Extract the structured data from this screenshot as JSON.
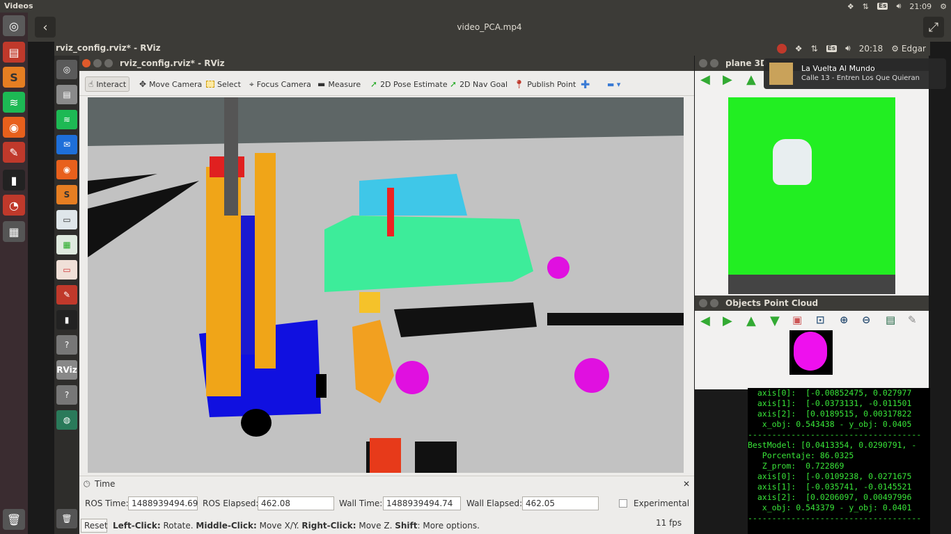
{
  "topbar": {
    "app_name": "Videos",
    "time": "21:09",
    "lang": "Es"
  },
  "video": {
    "title": "video_PCA.mp4",
    "back_icon": "chevron-left-icon",
    "fullscreen_icon": "fullscreen-icon"
  },
  "inner_top": {
    "title": "rviz_config.rviz* - RViz",
    "time": "20:18",
    "lang": "Es",
    "user": "Edgar"
  },
  "notification": {
    "title": "La Vuelta Al Mundo",
    "subtitle": "Calle 13 - Entren Los Que Quieran"
  },
  "rviz": {
    "title": "rviz_config.rviz* - RViz",
    "tools": [
      "Interact",
      "Move Camera",
      "Select",
      "Focus Camera",
      "Measure",
      "2D Pose Estimate",
      "2D Nav Goal",
      "Publish Point"
    ],
    "time_panel": {
      "title": "Time",
      "ros_time_label": "ROS Time:",
      "ros_time": "1488939494.69",
      "ros_elapsed_label": "ROS Elapsed:",
      "ros_elapsed": "462.08",
      "wall_time_label": "Wall Time:",
      "wall_time": "1488939494.74",
      "wall_elapsed_label": "Wall Elapsed:",
      "wall_elapsed": "462.05",
      "experimental_label": "Experimental"
    },
    "status": {
      "reset_label": "Reset",
      "left_click": "Left-Click:",
      "left_click_desc": " Rotate. ",
      "middle_click": "Middle-Click:",
      "middle_click_desc": " Move X/Y. ",
      "right_click": "Right-Click:",
      "right_click_desc": " Move Z. ",
      "shift": "Shift",
      "shift_desc": ": More options.",
      "fps": "11 fps"
    }
  },
  "plane3d": {
    "title": "plane 3D"
  },
  "objcloud": {
    "title": "Objects Point Cloud"
  },
  "terminal": {
    "lines": [
      "  axis[0]:  [-0.00852475, 0.027977",
      "  axis[1]:  [-0.0373131, -0.011501",
      "  axis[2]:  [0.0189515, 0.00317822",
      "   x_obj: 0.543438 - y_obj: 0.0405",
      "------------------------------------",
      "BestModel: [0.0413354, 0.0290791, -",
      "   Porcentaje: 86.0325",
      "   Z_prom:  0.722869",
      "  axis[0]:  [-0.0109238, 0.0271675",
      "  axis[1]:  [-0.035741, -0.0145521",
      "  axis[2]:  [0.0206097, 0.00497996",
      "   x_obj: 0.543379 - y_obj: 0.0401",
      "------------------------------------"
    ]
  }
}
